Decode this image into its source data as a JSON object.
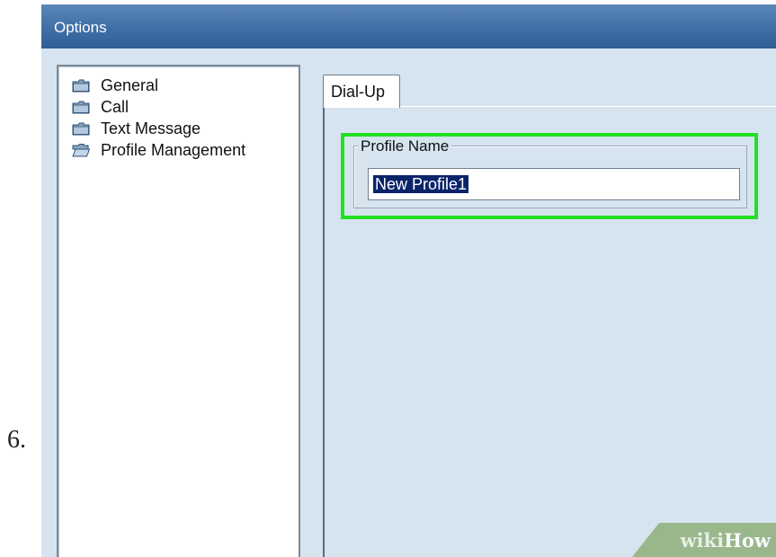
{
  "step": {
    "number": "6."
  },
  "window": {
    "title": "Options"
  },
  "tree": {
    "items": [
      {
        "label": "General",
        "icon": "folder-closed-icon",
        "state": "closed"
      },
      {
        "label": "Call",
        "icon": "folder-closed-icon",
        "state": "closed"
      },
      {
        "label": "Text Message",
        "icon": "folder-closed-icon",
        "state": "closed"
      },
      {
        "label": "Profile Management",
        "icon": "folder-open-icon",
        "state": "open"
      }
    ]
  },
  "tabs": [
    {
      "label": "Dial-Up",
      "active": true
    }
  ],
  "profile": {
    "group_label": "Profile Name",
    "value": "New Profile1"
  },
  "watermark": {
    "part1": "wiki",
    "part2": "How"
  },
  "colors": {
    "titlebar": "#3f6fa6",
    "panel_bg": "#d6e4f0",
    "highlight_box": "#22e022",
    "selection": "#0a246a",
    "watermark_bg": "#8fb07a"
  }
}
